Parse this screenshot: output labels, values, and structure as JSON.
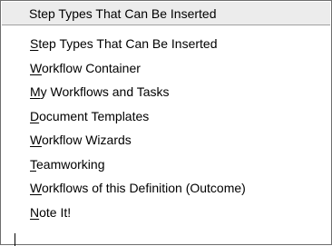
{
  "menu": {
    "header_label": "Step Types That Can Be Inserted",
    "items": [
      {
        "mnemonic": "S",
        "rest": "tep Types That Can Be Inserted"
      },
      {
        "mnemonic": "W",
        "rest": "orkflow Container"
      },
      {
        "mnemonic": "M",
        "rest": "y Workflows and Tasks"
      },
      {
        "mnemonic": "D",
        "rest": "ocument Templates"
      },
      {
        "mnemonic": "W",
        "rest": "orkflow Wizards"
      },
      {
        "mnemonic": "T",
        "rest": "eamworking"
      },
      {
        "mnemonic": "W",
        "rest": "orkflows of this Definition (Outcome)"
      },
      {
        "mnemonic": "N",
        "rest": "ote It!"
      }
    ]
  }
}
